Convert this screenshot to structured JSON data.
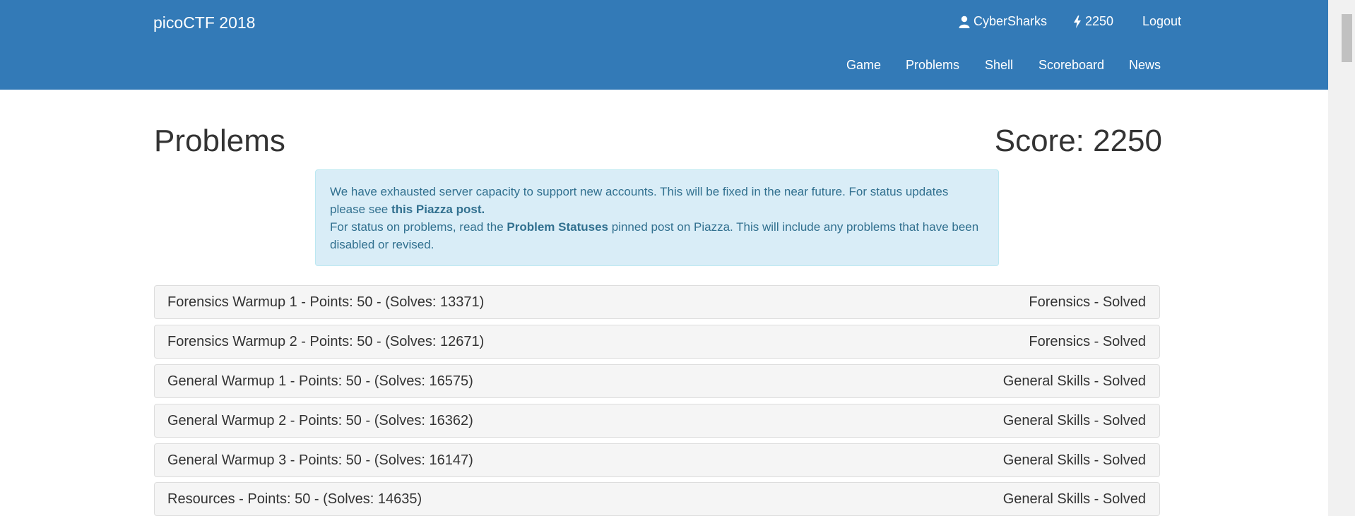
{
  "header": {
    "brand": "picoCTF 2018",
    "user_name": "CyberSharks",
    "points": "2250",
    "logout_label": "Logout",
    "nav": {
      "game": "Game",
      "problems": "Problems",
      "shell": "Shell",
      "scoreboard": "Scoreboard",
      "news": "News"
    },
    "icons": {
      "user": "user-icon",
      "points": "lightning-icon"
    }
  },
  "main": {
    "title": "Problems",
    "score_text": "Score: 2250",
    "alert": {
      "line1_text": "We have exhausted server capacity to support new accounts. This will be fixed in the near future. For status updates please see ",
      "line1_link": "this Piazza post.",
      "line2_prefix": "For status on problems, read the ",
      "line2_bold": "Problem Statuses",
      "line2_suffix": " pinned post on Piazza. This will include any problems that have been disabled or revised."
    },
    "problems": [
      {
        "label": "Forensics Warmup 1 - Points: 50 - (Solves: 13371)",
        "status": "Forensics - Solved"
      },
      {
        "label": "Forensics Warmup 2 - Points: 50 - (Solves: 12671)",
        "status": "Forensics - Solved"
      },
      {
        "label": "General Warmup 1 - Points: 50 - (Solves: 16575)",
        "status": "General Skills - Solved"
      },
      {
        "label": "General Warmup 2 - Points: 50 - (Solves: 16362)",
        "status": "General Skills - Solved"
      },
      {
        "label": "General Warmup 3 - Points: 50 - (Solves: 16147)",
        "status": "General Skills - Solved"
      },
      {
        "label": "Resources - Points: 50 - (Solves: 14635)",
        "status": "General Skills - Solved"
      }
    ]
  },
  "colors": {
    "navbar": "#337ab7",
    "alert_bg": "#d9edf7",
    "alert_text": "#31708f",
    "row_bg": "#f5f5f5"
  }
}
